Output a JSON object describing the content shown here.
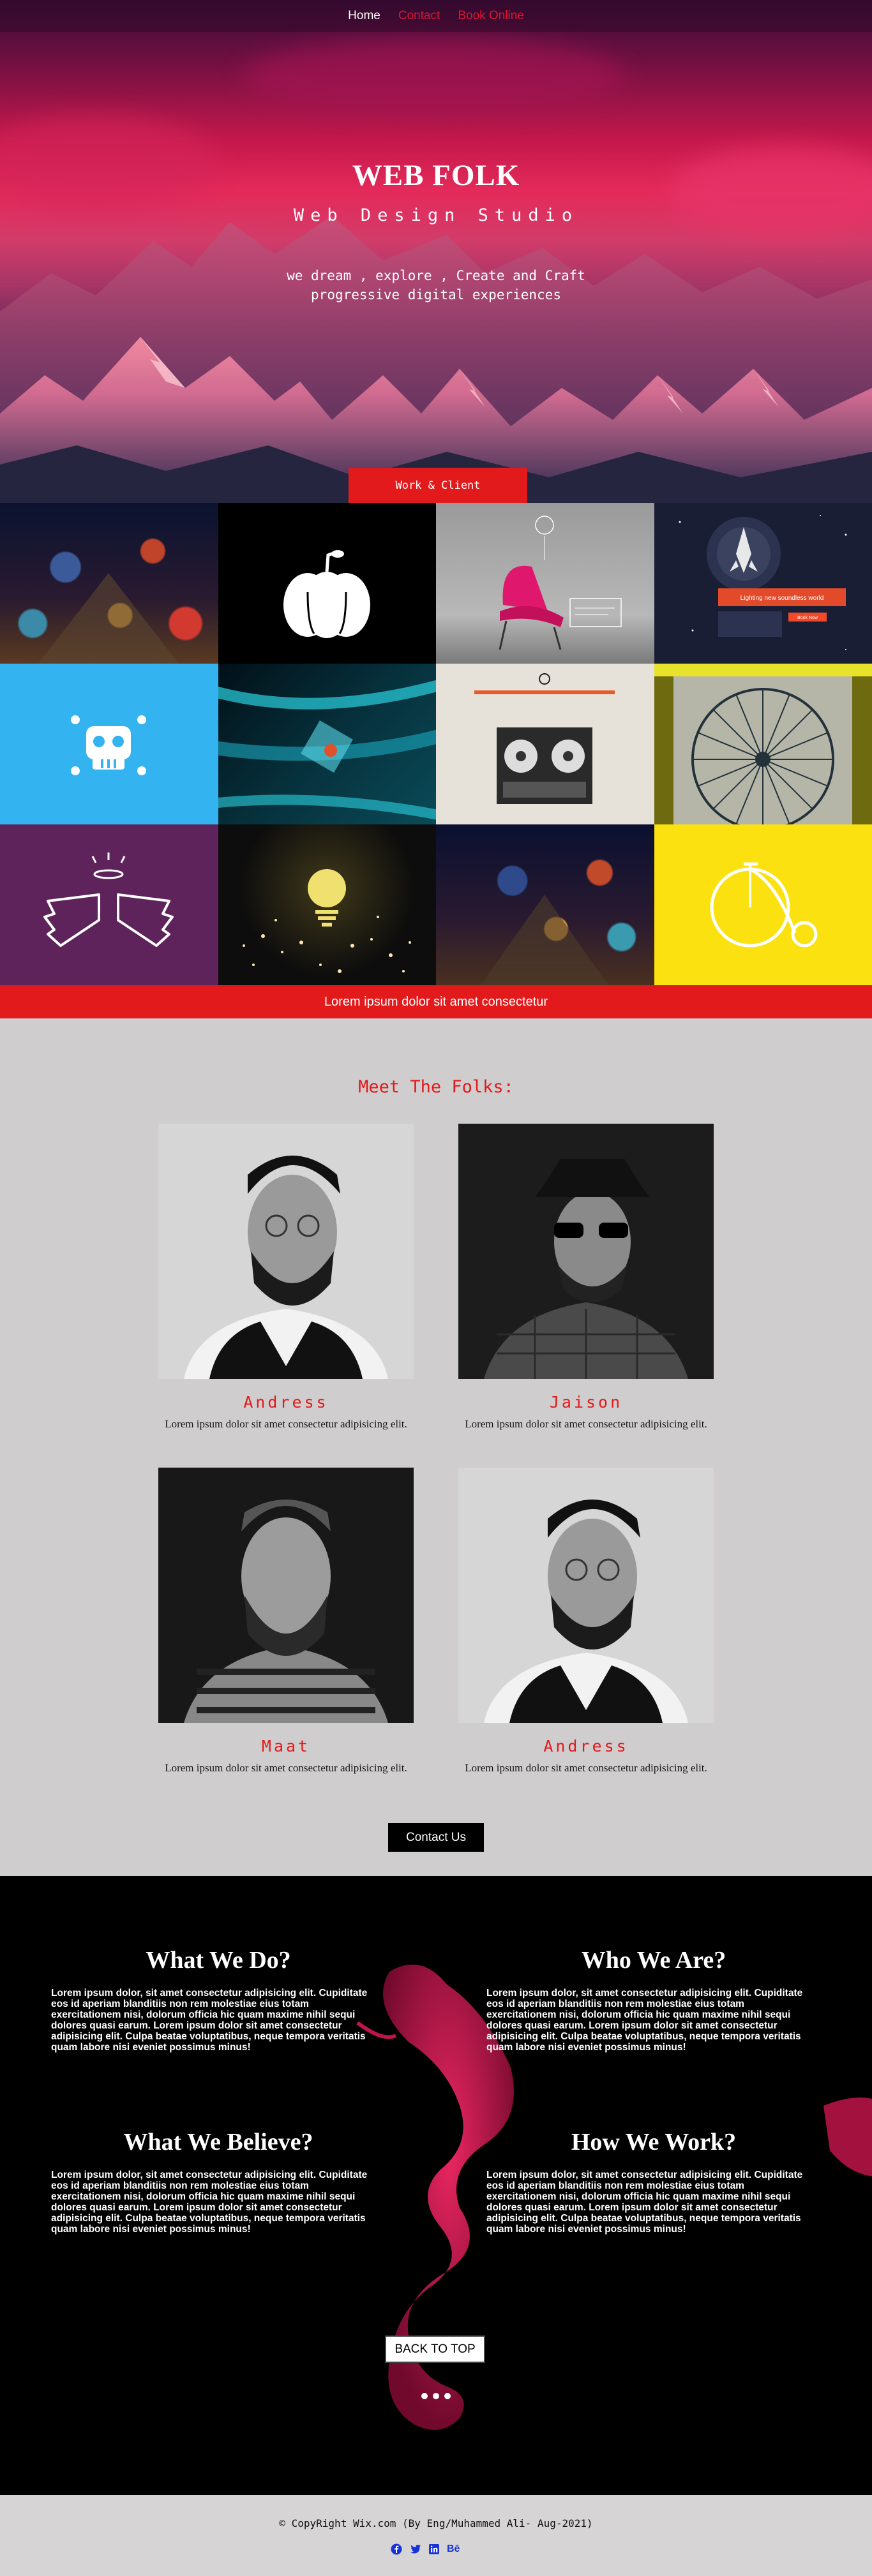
{
  "nav": {
    "home": "Home",
    "contact": "Contact",
    "book": "Book Online"
  },
  "hero": {
    "title": "WEB FOLK",
    "subtitle": "Web Design Studio",
    "tagline_1": "we dream , explore , Create and Craft",
    "tagline_2": "progressive digital experiences"
  },
  "work_ribbon": "Work & Client",
  "gallery_band": "Lorem ipsum dolor sit amet consectetur",
  "gallery_tiles": {
    "poster_text": "Lighting new soundless world",
    "book_label": "Book Now"
  },
  "team": {
    "heading": "Meet The Folks:",
    "members": [
      {
        "name": "Andress",
        "desc": "Lorem ipsum dolor sit amet consectetur adipisicing elit."
      },
      {
        "name": "Jaison",
        "desc": "Lorem ipsum dolor sit amet consectetur adipisicing elit."
      },
      {
        "name": "Maat",
        "desc": "Lorem ipsum dolor sit amet consectetur adipisicing elit."
      },
      {
        "name": "Andress",
        "desc": "Lorem ipsum dolor sit amet consectetur adipisicing elit."
      }
    ],
    "contact_button": "Contact Us"
  },
  "about": {
    "blocks": [
      {
        "title": "What We Do?",
        "text": "Lorem ipsum dolor, sit amet consectetur adipisicing elit. Cupiditate eos id aperiam blanditiis non rem molestiae eius totam exercitationem nisi, dolorum officia hic quam maxime nihil sequi dolores quasi earum. Lorem ipsum dolor sit amet consectetur adipisicing elit. Culpa beatae voluptatibus, neque tempora veritatis quam labore nisi eveniet possimus minus!"
      },
      {
        "title": "Who We Are?",
        "text": "Lorem ipsum dolor, sit amet consectetur adipisicing elit. Cupiditate eos id aperiam blanditiis non rem molestiae eius totam exercitationem nisi, dolorum officia hic quam maxime nihil sequi dolores quasi earum. Lorem ipsum dolor sit amet consectetur adipisicing elit. Culpa beatae voluptatibus, neque tempora veritatis quam labore nisi eveniet possimus minus!"
      },
      {
        "title": "What We Believe?",
        "text": "Lorem ipsum dolor, sit amet consectetur adipisicing elit. Cupiditate eos id aperiam blanditiis non rem molestiae eius totam exercitationem nisi, dolorum officia hic quam maxime nihil sequi dolores quasi earum. Lorem ipsum dolor sit amet consectetur adipisicing elit. Culpa beatae voluptatibus, neque tempora veritatis quam labore nisi eveniet possimus minus!"
      },
      {
        "title": "How We Work?",
        "text": "Lorem ipsum dolor, sit amet consectetur adipisicing elit. Cupiditate eos id aperiam blanditiis non rem molestiae eius totam exercitationem nisi, dolorum officia hic quam maxime nihil sequi dolores quasi earum. Lorem ipsum dolor sit amet consectetur adipisicing elit. Culpa beatae voluptatibus, neque tempora veritatis quam labore nisi eveniet possimus minus!"
      }
    ],
    "back_to_top": "BACK TO TOP"
  },
  "footer": {
    "copyright": "© CopyRight Wix.com (By Eng/Muhammed Ali- Aug-2021)",
    "behance": "Bē"
  },
  "colors": {
    "accent": "#e31a1c",
    "social": "#1732d8"
  }
}
